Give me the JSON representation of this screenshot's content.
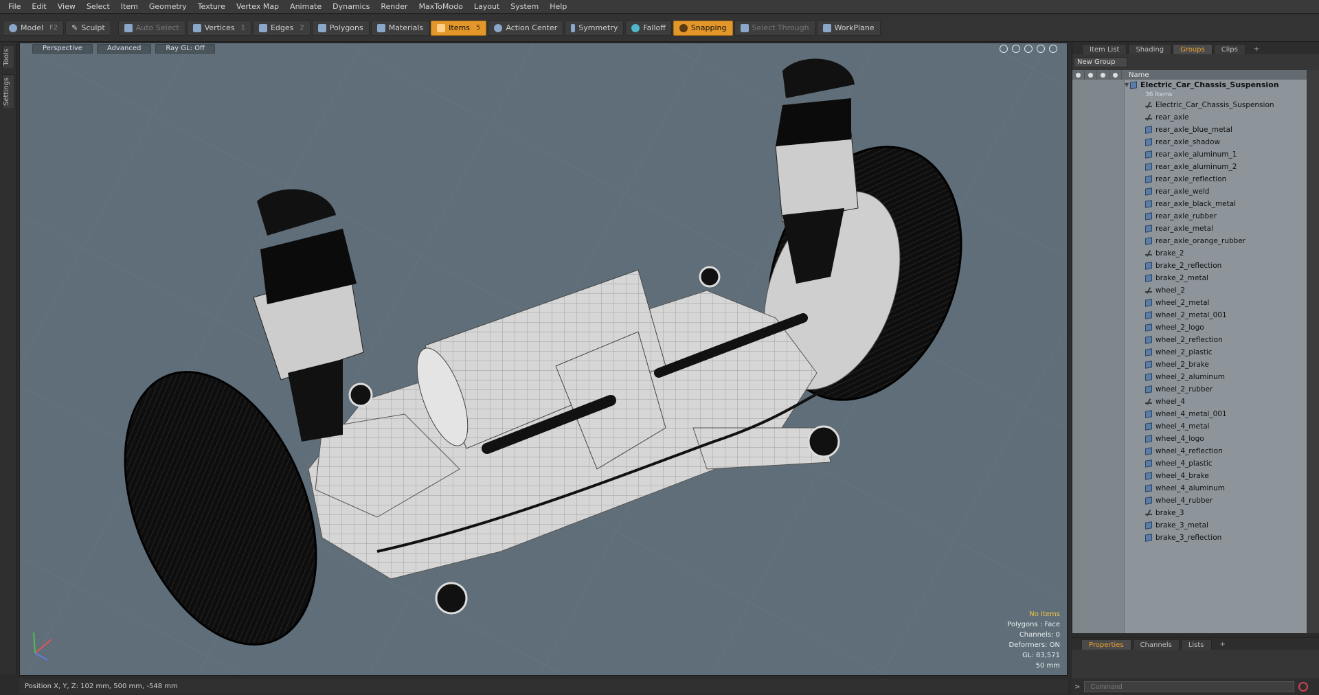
{
  "menu": [
    "File",
    "Edit",
    "View",
    "Select",
    "Item",
    "Geometry",
    "Texture",
    "Vertex Map",
    "Animate",
    "Dynamics",
    "Render",
    "MaxToModo",
    "Layout",
    "System",
    "Help"
  ],
  "toolbar": {
    "model": "Model",
    "model_key": "F2",
    "sculpt": "Sculpt",
    "auto_select": "Auto Select",
    "vertices": "Vertices",
    "vertices_key": "1",
    "edges": "Edges",
    "edges_key": "2",
    "polygons": "Polygons",
    "materials": "Materials",
    "items": "Items",
    "items_key": "5",
    "action_center": "Action Center",
    "symmetry": "Symmetry",
    "falloff": "Falloff",
    "snapping": "Snapping",
    "select_through": "Select Through",
    "workplane": "WorkPlane"
  },
  "left_tabs": [
    "Tools",
    "Settings"
  ],
  "viewport": {
    "view_mode": "Perspective",
    "shading": "Advanced",
    "raygl": "Ray GL: Off",
    "info": {
      "no_items": "No Items",
      "polygons": "Polygons : Face",
      "channels": "Channels: 0",
      "deformers": "Deformers: ON",
      "gl": "GL: 83,571",
      "scale": "50 mm"
    }
  },
  "status": {
    "position": "Position X, Y, Z:   102 mm, 500 mm, -548 mm"
  },
  "right_panel": {
    "tabs": [
      "Item List",
      "Shading",
      "Groups",
      "Clips",
      "+"
    ],
    "active_tab": "Groups",
    "new_group": "New Group",
    "column_name": "Name",
    "group": {
      "name": "Electric_Car_Chassis_Suspension",
      "count": "36 Items"
    },
    "items": [
      {
        "name": "Electric_Car_Chassis_Suspension",
        "kind": "locator"
      },
      {
        "name": "rear_axle",
        "kind": "locator"
      },
      {
        "name": "rear_axle_blue_metal",
        "kind": "mesh"
      },
      {
        "name": "rear_axle_shadow",
        "kind": "mesh"
      },
      {
        "name": "rear_axle_aluminum_1",
        "kind": "mesh"
      },
      {
        "name": "rear_axle_aluminum_2",
        "kind": "mesh"
      },
      {
        "name": "rear_axle_reflection",
        "kind": "mesh"
      },
      {
        "name": "rear_axle_weld",
        "kind": "mesh"
      },
      {
        "name": "rear_axle_black_metal",
        "kind": "mesh"
      },
      {
        "name": "rear_axle_rubber",
        "kind": "mesh"
      },
      {
        "name": "rear_axle_metal",
        "kind": "mesh"
      },
      {
        "name": "rear_axle_orange_rubber",
        "kind": "mesh"
      },
      {
        "name": "brake_2",
        "kind": "locator"
      },
      {
        "name": "brake_2_reflection",
        "kind": "mesh"
      },
      {
        "name": "brake_2_metal",
        "kind": "mesh"
      },
      {
        "name": "wheel_2",
        "kind": "locator"
      },
      {
        "name": "wheel_2_metal",
        "kind": "mesh"
      },
      {
        "name": "wheel_2_metal_001",
        "kind": "mesh"
      },
      {
        "name": "wheel_2_logo",
        "kind": "mesh"
      },
      {
        "name": "wheel_2_reflection",
        "kind": "mesh"
      },
      {
        "name": "wheel_2_plastic",
        "kind": "mesh"
      },
      {
        "name": "wheel_2_brake",
        "kind": "mesh"
      },
      {
        "name": "wheel_2_aluminum",
        "kind": "mesh"
      },
      {
        "name": "wheel_2_rubber",
        "kind": "mesh"
      },
      {
        "name": "wheel_4",
        "kind": "locator"
      },
      {
        "name": "wheel_4_metal_001",
        "kind": "mesh"
      },
      {
        "name": "wheel_4_metal",
        "kind": "mesh"
      },
      {
        "name": "wheel_4_logo",
        "kind": "mesh"
      },
      {
        "name": "wheel_4_reflection",
        "kind": "mesh"
      },
      {
        "name": "wheel_4_plastic",
        "kind": "mesh"
      },
      {
        "name": "wheel_4_brake",
        "kind": "mesh"
      },
      {
        "name": "wheel_4_aluminum",
        "kind": "mesh"
      },
      {
        "name": "wheel_4_rubber",
        "kind": "mesh"
      },
      {
        "name": "brake_3",
        "kind": "locator"
      },
      {
        "name": "brake_3_metal",
        "kind": "mesh"
      },
      {
        "name": "brake_3_reflection",
        "kind": "mesh"
      }
    ]
  },
  "bottom_panel": {
    "tabs": [
      "Properties",
      "Channels",
      "Lists",
      "+"
    ],
    "active_tab": "Properties",
    "command_placeholder": "Command"
  },
  "colors": {
    "accent": "#e3962a",
    "viewport_bg": "#5f6e78",
    "list_bg": "#8d949a"
  }
}
